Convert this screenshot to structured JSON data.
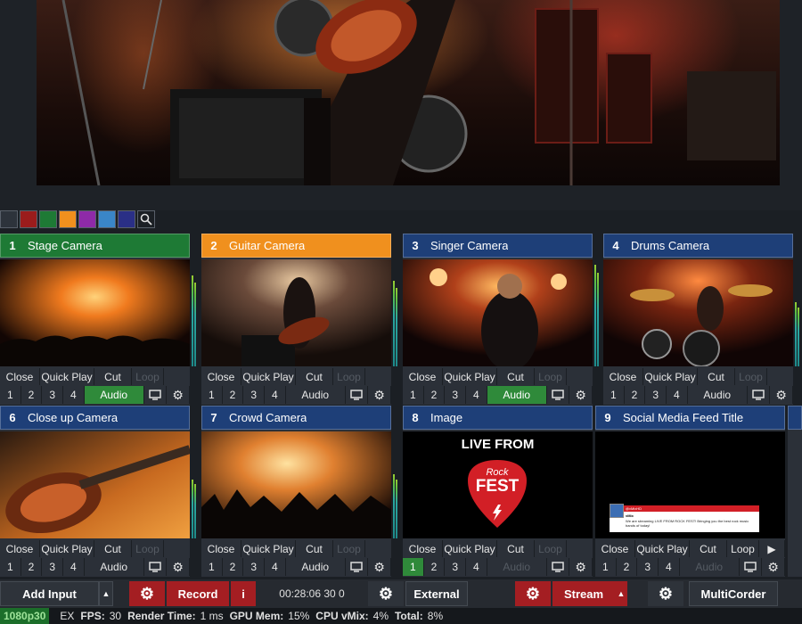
{
  "inputs": [
    {
      "num": "1",
      "name": "Stage Camera",
      "color": "#1e7a35",
      "buttons": {
        "close": "Close",
        "quick_play": "Quick Play",
        "cut": "Cut",
        "loop": "Loop",
        "n1": "1",
        "n2": "2",
        "n3": "3",
        "n4": "4",
        "audio": "Audio"
      },
      "audio_active": true,
      "meter_level": 0.85
    },
    {
      "num": "2",
      "name": "Guitar Camera",
      "color": "#f0901e",
      "buttons": {
        "close": "Close",
        "quick_play": "Quick Play",
        "cut": "Cut",
        "loop": "Loop",
        "n1": "1",
        "n2": "2",
        "n3": "3",
        "n4": "4",
        "audio": "Audio"
      },
      "audio_active": false,
      "meter_level": 0.8
    },
    {
      "num": "3",
      "name": "Singer Camera",
      "color": "#1e3f78",
      "buttons": {
        "close": "Close",
        "quick_play": "Quick Play",
        "cut": "Cut",
        "loop": "Loop",
        "n1": "1",
        "n2": "2",
        "n3": "3",
        "n4": "4",
        "audio": "Audio"
      },
      "audio_active": true,
      "meter_level": 0.95
    },
    {
      "num": "4",
      "name": "Drums Camera",
      "color": "#1e3f78",
      "buttons": {
        "close": "Close",
        "quick_play": "Quick Play",
        "cut": "Cut",
        "loop": "Loop",
        "n1": "1",
        "n2": "2",
        "n3": "3",
        "n4": "4",
        "audio": "Audio"
      },
      "audio_active": false,
      "meter_level": 0.6
    },
    {
      "num": "6",
      "name": "Close up Camera",
      "color": "#1e3f78",
      "buttons": {
        "close": "Close",
        "quick_play": "Quick Play",
        "cut": "Cut",
        "loop": "Loop",
        "n1": "1",
        "n2": "2",
        "n3": "3",
        "n4": "4",
        "audio": "Audio"
      },
      "audio_active": false,
      "meter_level": 0.55
    },
    {
      "num": "7",
      "name": "Crowd Camera",
      "color": "#1e3f78",
      "buttons": {
        "close": "Close",
        "quick_play": "Quick Play",
        "cut": "Cut",
        "loop": "Loop",
        "n1": "1",
        "n2": "2",
        "n3": "3",
        "n4": "4",
        "audio": "Audio"
      },
      "audio_active": false,
      "meter_level": 0.6
    },
    {
      "num": "8",
      "name": "Image",
      "color": "#1e3f78",
      "buttons": {
        "close": "Close",
        "quick_play": "Quick Play",
        "cut": "Cut",
        "loop": "Loop",
        "n1": "1",
        "n2": "2",
        "n3": "3",
        "n4": "4",
        "audio": "Audio"
      },
      "audio_active": false,
      "meter_level": 0
    },
    {
      "num": "9",
      "name": "Social Media Feed Title",
      "color": "#1e3f78",
      "buttons": {
        "close": "Close",
        "quick_play": "Quick Play",
        "cut": "Cut",
        "loop": "Loop",
        "n1": "1",
        "n2": "2",
        "n3": "3",
        "n4": "4",
        "audio": "Audio"
      },
      "audio_active": false,
      "meter_level": 0
    }
  ],
  "image_input": {
    "line1": "LIVE FROM",
    "logo_top": "Rock",
    "logo_main": "FEST"
  },
  "social": {
    "handle": "@vMixHD",
    "name": "vMix",
    "message": "We are streaming LIVE FROM ROCK FEST! Bringing you the best rock music bands of today!"
  },
  "color_tabs": [
    "#2d333b",
    "#9b1c1c",
    "#1e7a35",
    "#f0901e",
    "#8e2aa8",
    "#3a86c8",
    "#2a2f86"
  ],
  "toolbar": {
    "add_input": "Add Input",
    "record": "Record",
    "record_info": "i",
    "timecode": "00:28:06 30 0",
    "external": "External",
    "stream": "Stream",
    "multicorder": "MultiCorder"
  },
  "status": {
    "resolution": "1080p30",
    "ex": "EX",
    "fps_label": "FPS:",
    "fps": "30",
    "render_label": "Render Time:",
    "render": "1 ms",
    "gpu_label": "GPU Mem:",
    "gpu": "15%",
    "cpu_label": "CPU vMix:",
    "cpu": "4%",
    "total_label": "Total:",
    "total": "8%"
  }
}
